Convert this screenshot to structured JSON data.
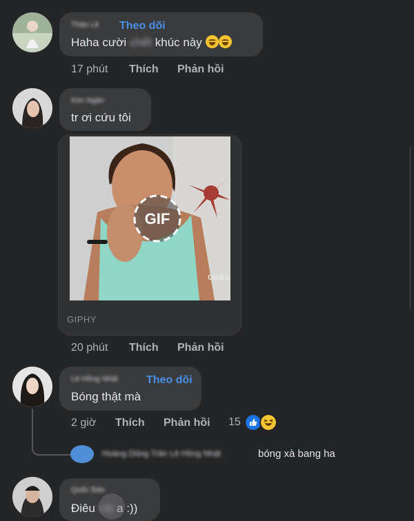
{
  "comments": [
    {
      "author": "Thảo Lê",
      "follow": "Theo dõi",
      "text_before": "Haha cười ",
      "text_blur": "chết",
      "text_after": " khúc này",
      "emojis": [
        "rolling-laughing-emoji",
        "rolling-laughing-emoji"
      ],
      "time": "17 phút",
      "like": "Thích",
      "reply": "Phản hồi"
    },
    {
      "author": "Kim Ngân",
      "text": "tr ơi cứu tôi",
      "gif": {
        "badge": "GIF",
        "watermark": "Globa",
        "source": "GIPHY"
      },
      "time": "20 phút",
      "like": "Thích",
      "reply": "Phản hồi"
    },
    {
      "author": "Lê Hồng Nhật",
      "follow": "Theo dõi",
      "text": "Bóng thật mà",
      "time": "2 giờ",
      "like": "Thích",
      "reply": "Phản hồi",
      "reaction_count": "15",
      "reactions": [
        "like-reaction-icon",
        "haha-reaction-icon"
      ],
      "reply_preview": {
        "author": "Hoàng Dũng Trần Lê Hồng Nhật",
        "text": "bóng xà bang ha"
      }
    },
    {
      "author": "Quốc Bảo",
      "text_before": "Điêu ",
      "text_blur": "vãi",
      "text_after": " a :))"
    }
  ],
  "colors": {
    "background": "#242526",
    "bubble": "#3a3b3c",
    "link": "#4a90e8",
    "meta": "#b0b3b8"
  }
}
